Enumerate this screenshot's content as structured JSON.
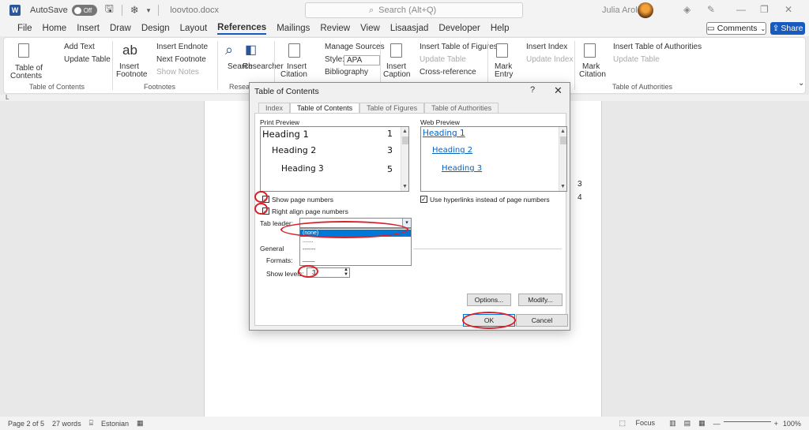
{
  "titlebar": {
    "autosave_label": "AutoSave",
    "autosave_state": "Off",
    "doc_name": "loovtoo.docx",
    "search_placeholder": "Search (Alt+Q)",
    "user_name": "Julia Arold"
  },
  "menu": {
    "tabs": [
      "File",
      "Home",
      "Insert",
      "Draw",
      "Design",
      "Layout",
      "References",
      "Mailings",
      "Review",
      "View",
      "Lisaasjad",
      "Developer",
      "Help"
    ],
    "active_tab": "References",
    "comments_label": "Comments",
    "share_label": "Share"
  },
  "ribbon": {
    "toc": {
      "add_text": "Add Text",
      "update_table": "Update Table",
      "table_of_1": "Table of",
      "table_of_2": "Contents",
      "group": "Table of Contents"
    },
    "footnotes": {
      "insert_endnote": "Insert Endnote",
      "next_footnote": "Next Footnote",
      "show_notes": "Show Notes",
      "insert_1": "Insert",
      "insert_2": "Footnote",
      "group": "Footnotes"
    },
    "research": {
      "search": "Search",
      "researcher": "Researcher",
      "group": "Researc"
    },
    "citations": {
      "manage_sources": "Manage Sources",
      "style_label": "Style:",
      "style_value": "APA",
      "bibliography": "Bibliography",
      "insert_1": "Insert",
      "insert_2": "Citation"
    },
    "captions": {
      "insert_table_of_figures": "Insert Table of Figures",
      "update_table": "Update Table",
      "cross_reference": "Cross-reference",
      "insert_1": "Insert",
      "insert_2": "Caption"
    },
    "index": {
      "insert_index": "Insert Index",
      "update_index": "Update Index",
      "mark_1": "Mark",
      "mark_2": "Entry"
    },
    "authorities": {
      "insert_toa": "Insert Table of Authorities",
      "update_table": "Update Table",
      "mark_1": "Mark",
      "mark_2": "Citation",
      "group": "Table of Authorities"
    }
  },
  "document": {
    "page_numbers": [
      "3",
      "4"
    ]
  },
  "dialog": {
    "title": "Table of Contents",
    "help": "?",
    "close": "✕",
    "tabs": [
      "Index",
      "Table of Contents",
      "Table of Figures",
      "Table of Authorities"
    ],
    "active_tab": "Table of Contents",
    "print_preview_label": "Print Preview",
    "web_preview_label": "Web Preview",
    "print_preview": [
      {
        "heading": "Heading 1",
        "page": "1"
      },
      {
        "heading": "Heading 2",
        "page": "3"
      },
      {
        "heading": "Heading 3",
        "page": "5"
      }
    ],
    "web_preview": [
      "Heading 1",
      "Heading 2",
      "Heading 3"
    ],
    "show_page_numbers": {
      "label": "Show page numbers",
      "checked": true
    },
    "right_align": {
      "label": "Right align page numbers",
      "checked": true
    },
    "use_hyperlinks": {
      "label": "Use hyperlinks instead of page numbers",
      "checked": true
    },
    "tab_leader_label": "Tab leader:",
    "tab_leader_options": [
      "(none)",
      ".......",
      "-------",
      "____"
    ],
    "tab_leader_selected": "(none)",
    "general_label": "General",
    "formats_label": "Formats:",
    "show_levels_label": "Show levels:",
    "show_levels_value": "3",
    "options_button": "Options...",
    "modify_button": "Modify...",
    "ok_button": "OK",
    "cancel_button": "Cancel"
  },
  "statusbar": {
    "page": "Page 2 of 5",
    "words": "27 words",
    "language": "Estonian",
    "focus": "Focus",
    "zoom": "100%"
  },
  "colors": {
    "accent": "#185abd",
    "annotation": "#d9202a",
    "link": "#0563c1",
    "selection": "#0078d7"
  }
}
